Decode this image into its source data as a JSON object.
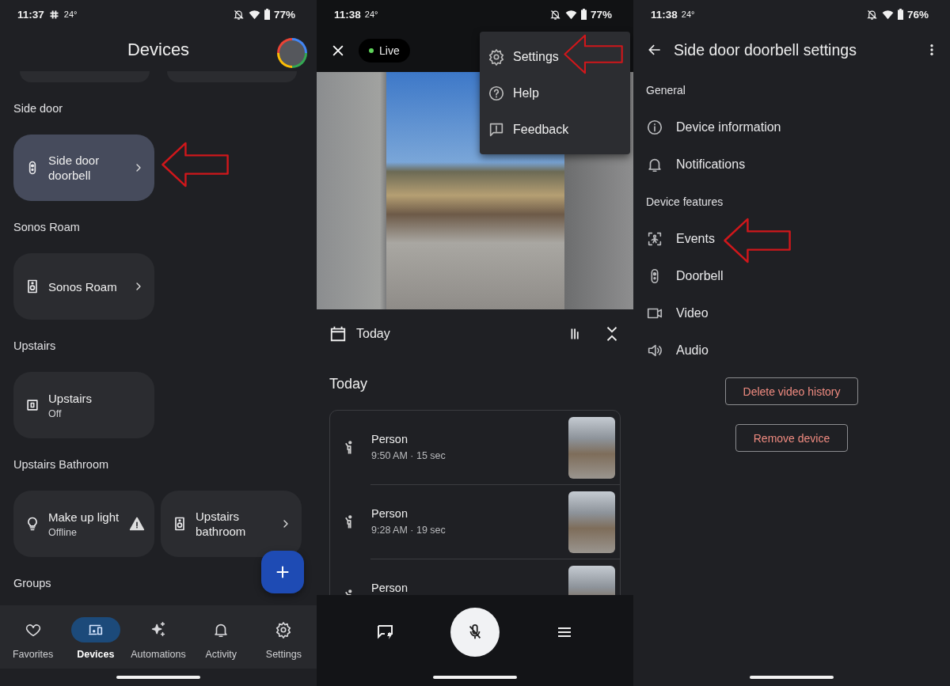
{
  "devices_screen": {
    "status_bar": {
      "time": "11:37",
      "temperature": "24°",
      "battery": "77%"
    },
    "title": "Devices",
    "sections": [
      {
        "heading": "Side door",
        "devices": [
          {
            "name": "Side door doorbell",
            "kind": "doorbell",
            "selected": true,
            "has_detail": true,
            "warning": false
          }
        ]
      },
      {
        "heading": "Sonos Roam",
        "devices": [
          {
            "name": "Sonos Roam",
            "kind": "speaker",
            "selected": false,
            "has_detail": true,
            "warning": false
          }
        ]
      },
      {
        "heading": "Upstairs",
        "devices": [
          {
            "name": "Upstairs",
            "status": "Off",
            "kind": "outlet",
            "selected": false,
            "has_detail": false,
            "warning": false
          }
        ]
      },
      {
        "heading": "Upstairs Bathroom",
        "devices": [
          {
            "name": "Make up light",
            "status": "Offline",
            "kind": "bulb",
            "selected": false,
            "has_detail": false,
            "warning": true
          },
          {
            "name": "Upstairs bathroom",
            "kind": "speaker",
            "selected": false,
            "has_detail": true,
            "warning": false
          }
        ]
      },
      {
        "heading": "Groups"
      }
    ],
    "nav": [
      {
        "label": "Favorites",
        "kind": "heart",
        "selected": false
      },
      {
        "label": "Devices",
        "kind": "devices",
        "selected": true
      },
      {
        "label": "Automations",
        "kind": "sparkle",
        "selected": false
      },
      {
        "label": "Activity",
        "kind": "bell",
        "selected": false
      },
      {
        "label": "Settings",
        "kind": "gear",
        "selected": false
      }
    ]
  },
  "camera_screen": {
    "status_bar": {
      "time": "11:38",
      "temperature": "24°",
      "battery": "77%"
    },
    "live_label": "Live",
    "menu": [
      {
        "label": "Settings",
        "kind": "gear"
      },
      {
        "label": "Help",
        "kind": "help"
      },
      {
        "label": "Feedback",
        "kind": "feedback"
      }
    ],
    "date_label": "Today",
    "list_heading": "Today",
    "events": [
      {
        "label": "Person",
        "time": "9:50 AM · 15 sec"
      },
      {
        "label": "Person",
        "time": "9:28 AM · 19 sec"
      },
      {
        "label": "Person"
      }
    ]
  },
  "settings_screen": {
    "status_bar": {
      "time": "11:38",
      "temperature": "24°",
      "battery": "76%"
    },
    "title": "Side door doorbell settings",
    "sections": [
      {
        "heading": "General",
        "items": [
          {
            "label": "Device information",
            "kind": "info"
          },
          {
            "label": "Notifications",
            "kind": "bell"
          }
        ]
      },
      {
        "heading": "Device features",
        "items": [
          {
            "label": "Events",
            "kind": "events"
          },
          {
            "label": "Doorbell",
            "kind": "doorbell"
          },
          {
            "label": "Video",
            "kind": "video"
          },
          {
            "label": "Audio",
            "kind": "audio"
          }
        ]
      }
    ],
    "buttons": [
      "Delete video history",
      "Remove device"
    ]
  }
}
